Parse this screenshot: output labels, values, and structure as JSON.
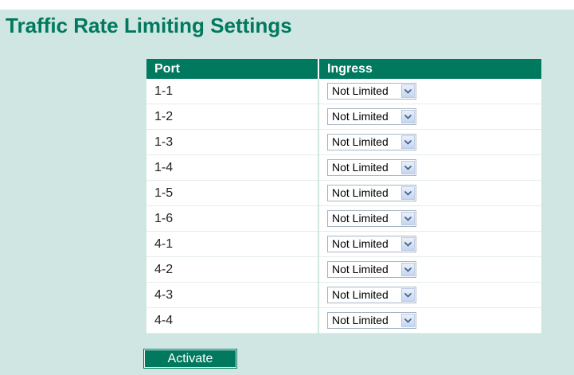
{
  "page": {
    "title": "Traffic Rate Limiting Settings"
  },
  "table": {
    "headers": [
      "Port",
      "Ingress"
    ],
    "rows": [
      {
        "port": "1-1",
        "ingress": "Not Limited"
      },
      {
        "port": "1-2",
        "ingress": "Not Limited"
      },
      {
        "port": "1-3",
        "ingress": "Not Limited"
      },
      {
        "port": "1-4",
        "ingress": "Not Limited"
      },
      {
        "port": "1-5",
        "ingress": "Not Limited"
      },
      {
        "port": "1-6",
        "ingress": "Not Limited"
      },
      {
        "port": "4-1",
        "ingress": "Not Limited"
      },
      {
        "port": "4-2",
        "ingress": "Not Limited"
      },
      {
        "port": "4-3",
        "ingress": "Not Limited"
      },
      {
        "port": "4-4",
        "ingress": "Not Limited"
      }
    ]
  },
  "actions": {
    "activate_label": "Activate"
  },
  "colors": {
    "brand_green": "#00795f",
    "panel_background": "#cfe6e3"
  },
  "icons": {
    "dropdown": "chevron-down-icon"
  }
}
